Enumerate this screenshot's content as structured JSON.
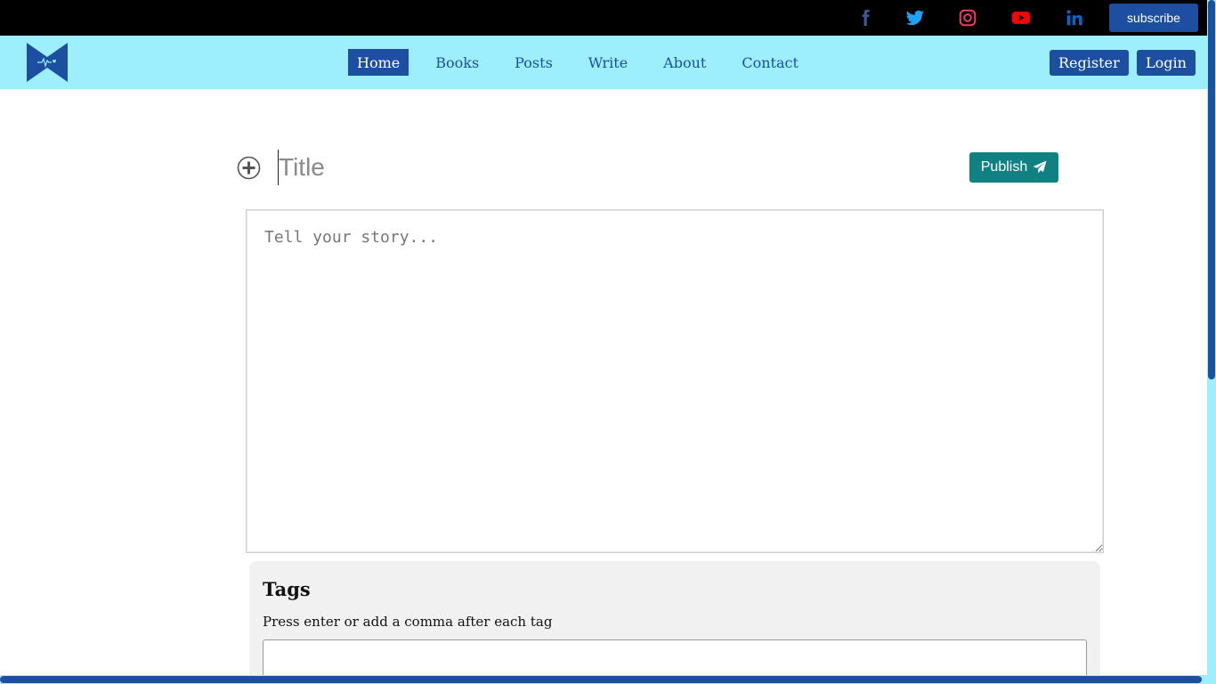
{
  "topbar": {
    "social_icons": [
      "facebook-icon",
      "twitter-icon",
      "instagram-icon",
      "youtube-icon",
      "linkedin-icon"
    ],
    "subscribe_label": "subscribe"
  },
  "nav": {
    "links": [
      "Home",
      "Books",
      "Posts",
      "Write",
      "About",
      "Contact"
    ],
    "active": "Home",
    "register_label": "Register",
    "login_label": "Login"
  },
  "editor": {
    "title_placeholder": "Title",
    "publish_label": "Publish",
    "story_placeholder": "Tell your story..."
  },
  "tags": {
    "heading": "Tags",
    "hint": "Press enter or add a comma after each tag",
    "value": ""
  },
  "colors": {
    "topbar_bg": "#000000",
    "nav_bg": "#9deffd",
    "primary": "#1d4fa0",
    "publish": "#0f8183",
    "facebook": "#3b5998",
    "twitter": "#1da1f2",
    "instagram": "#e4405f",
    "youtube": "#ff0000",
    "linkedin": "#0a66c2"
  }
}
